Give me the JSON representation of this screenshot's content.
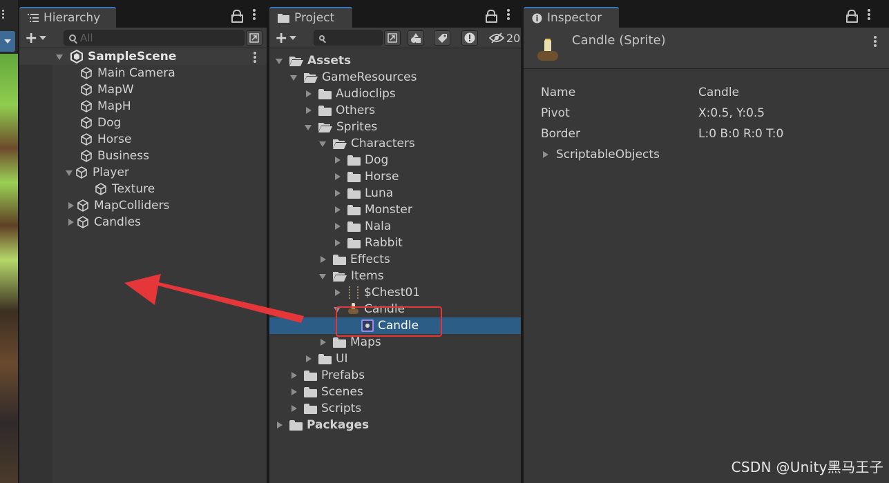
{
  "hierarchy": {
    "tab_title": "Hierarchy",
    "search_placeholder": "All",
    "items": [
      {
        "label": "SampleScene",
        "kind": "scene"
      },
      {
        "label": "Main Camera"
      },
      {
        "label": "MapW"
      },
      {
        "label": "MapH"
      },
      {
        "label": "Dog"
      },
      {
        "label": "Horse"
      },
      {
        "label": "Business"
      },
      {
        "label": "Player",
        "expanded": true
      },
      {
        "label": "Texture"
      },
      {
        "label": "MapColliders",
        "expanded": false
      },
      {
        "label": "Candles",
        "expanded": false
      }
    ]
  },
  "project": {
    "tab_title": "Project",
    "hidden_count": "20",
    "tree": [
      {
        "label": "Assets",
        "bold": true
      },
      {
        "label": "GameResources"
      },
      {
        "label": "Audioclips"
      },
      {
        "label": "Others"
      },
      {
        "label": "Sprites"
      },
      {
        "label": "Characters"
      },
      {
        "label": "Dog"
      },
      {
        "label": "Horse"
      },
      {
        "label": "Luna"
      },
      {
        "label": "Monster"
      },
      {
        "label": "Nala"
      },
      {
        "label": "Rabbit"
      },
      {
        "label": "Effects"
      },
      {
        "label": "Items"
      },
      {
        "label": "$Chest01"
      },
      {
        "label": "Candle"
      },
      {
        "label": "Candle",
        "selected": true
      },
      {
        "label": "Maps"
      },
      {
        "label": "UI"
      },
      {
        "label": "Prefabs"
      },
      {
        "label": "Scenes"
      },
      {
        "label": "Scripts"
      },
      {
        "label": "Packages",
        "bold": true
      }
    ]
  },
  "inspector": {
    "tab_title": "Inspector",
    "object_name": "Candle (Sprite)",
    "properties": [
      {
        "label": "Name",
        "value": "Candle"
      },
      {
        "label": "Pivot",
        "value": "X:0.5, Y:0.5"
      },
      {
        "label": "Border",
        "value": "L:0 B:0 R:0 T:0"
      }
    ],
    "foldout": "ScriptableObjects"
  },
  "colors": {
    "selection": "#2c5d87",
    "annotation_red": "#e5363a",
    "panel_bg": "#383838"
  },
  "watermark": "CSDN @Unity黑马王子"
}
